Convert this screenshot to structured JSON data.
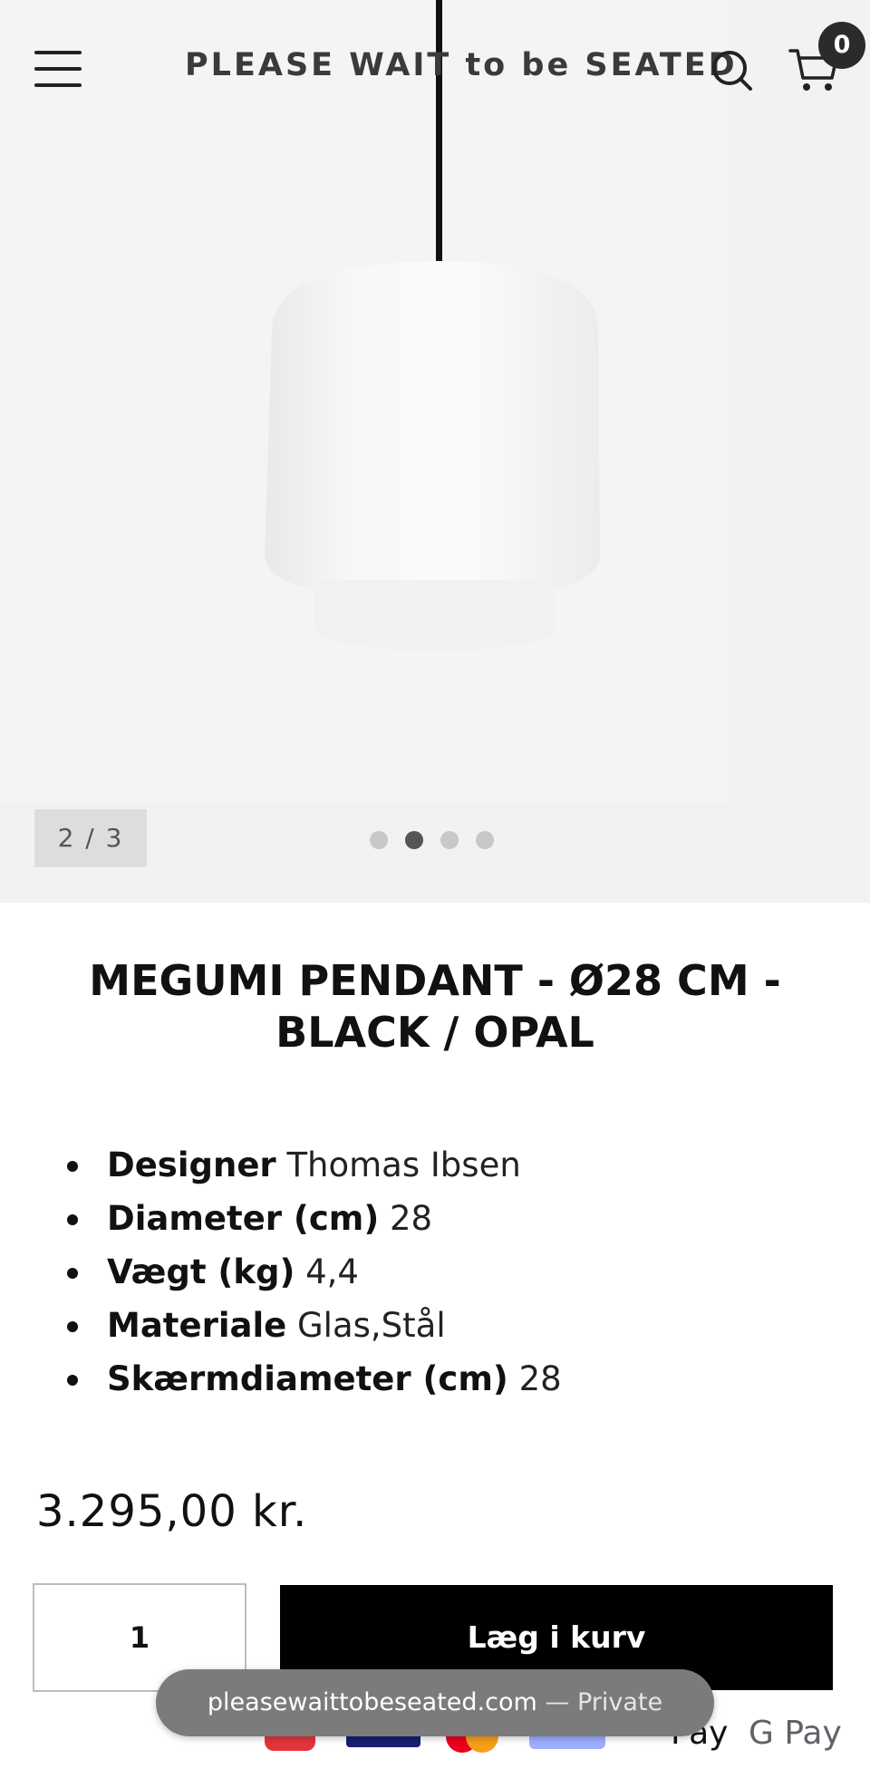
{
  "header": {
    "brand": "PLEASE WAIT to be SEATED",
    "cart_count": "0",
    "icons": [
      "menu-icon",
      "search-icon",
      "cart-icon"
    ]
  },
  "gallery": {
    "counter": "2 / 3",
    "dots": 4,
    "active_dot": 2
  },
  "product": {
    "title": "MEGUMI PENDANT - Ø28 CM - BLACK / OPAL",
    "specs": [
      {
        "key": "Designer",
        "value": "Thomas Ibsen"
      },
      {
        "key": "Diameter (cm)",
        "value": "28"
      },
      {
        "key": "Vægt (kg)",
        "value": "4,4"
      },
      {
        "key": "Materiale",
        "value": "Glas,Stål"
      },
      {
        "key": "Skærmdiameter (cm)",
        "value": "28"
      }
    ],
    "price": "3.295,00 kr.",
    "quantity": "1",
    "add_to_cart": "Læg i kurv"
  },
  "payments": {
    "labels": [
      "Pay",
      "G Pay"
    ]
  },
  "browser": {
    "url": "pleasewaittobeseated.com",
    "separator": "—",
    "mode": "Private"
  },
  "colors": {
    "button_bg": "#000000",
    "hero_bg": "#f2f2f2",
    "text": "#111111"
  }
}
